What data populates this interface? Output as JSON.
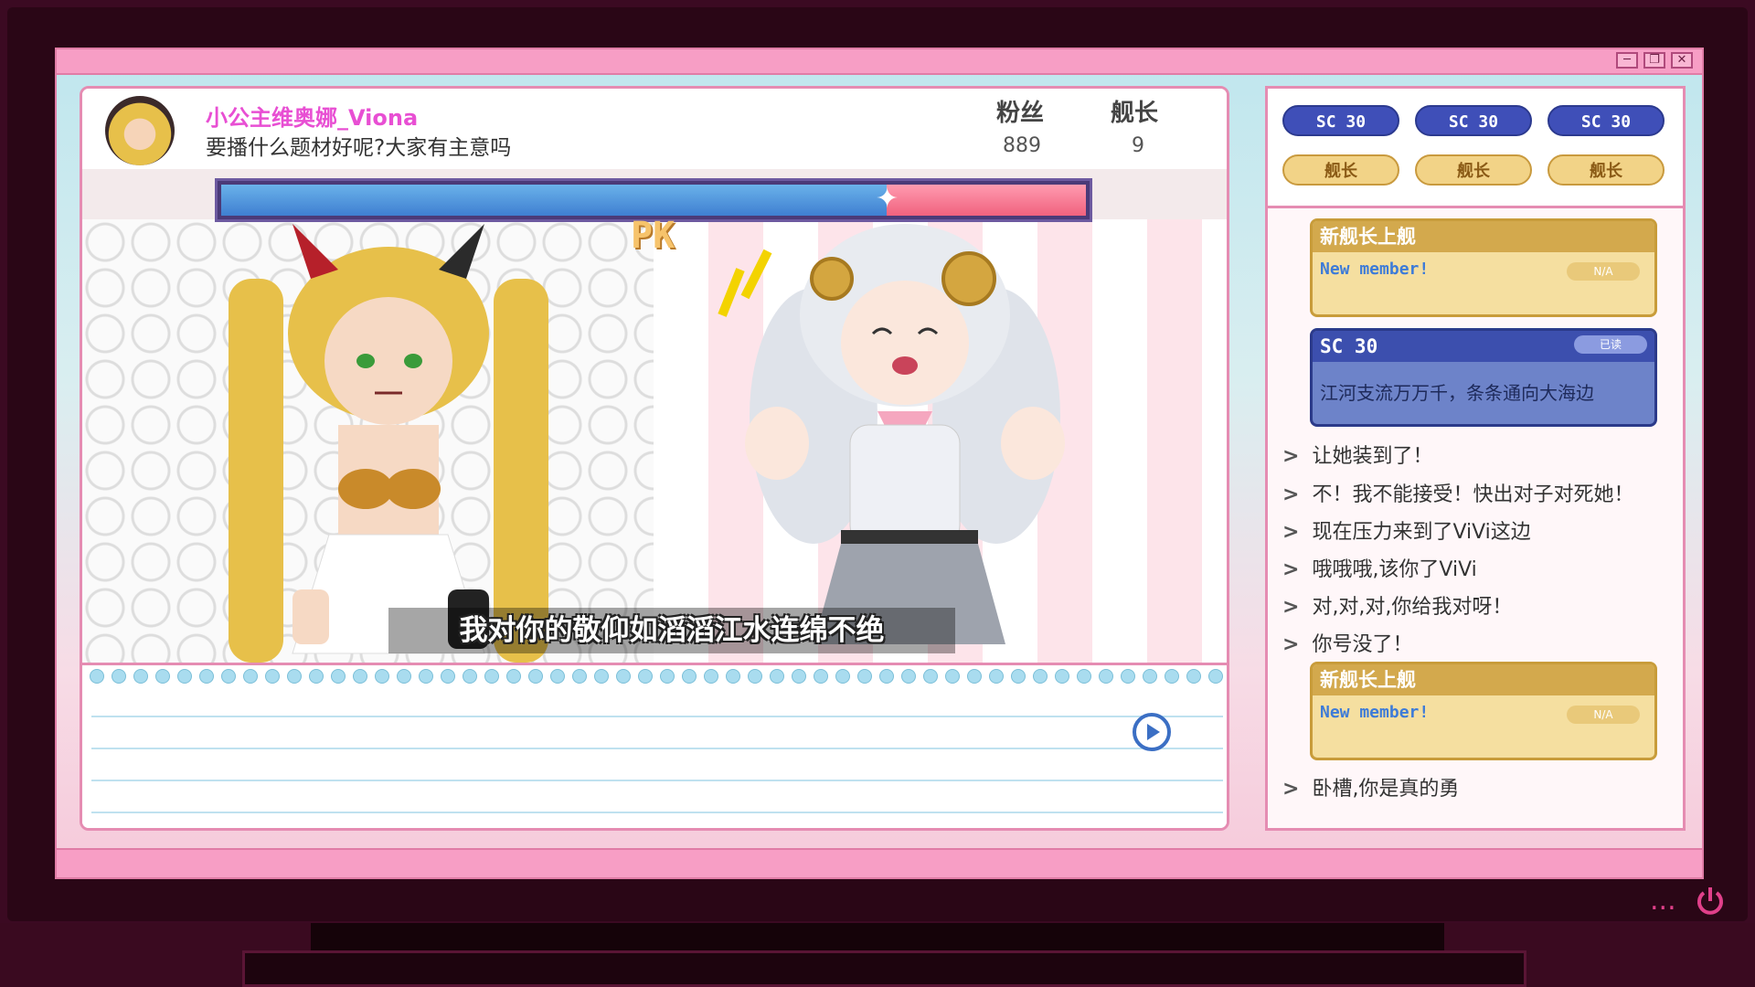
{
  "streamer": {
    "name": "小公主维奥娜_Viona",
    "message": "要播什么题材好呢?大家有主意吗"
  },
  "stats": {
    "fans_label": "粉丝",
    "fans_value": "889",
    "captain_label": "舰长",
    "captain_value": "9"
  },
  "pk": {
    "label": "PK",
    "left_share": 0.77,
    "left_color": "#3f7fd1",
    "right_color": "#f0627e"
  },
  "subtitle": "我对你的敬仰如滔滔江水连绵不绝",
  "side": {
    "sc_pills": [
      "SC 30",
      "SC 30",
      "SC 30"
    ],
    "captain_pills": [
      "舰长",
      "舰长",
      "舰长"
    ],
    "card1": {
      "title": "新舰长上舰",
      "badge": "N/A",
      "body": "New member!"
    },
    "card2": {
      "title": "SC 30",
      "badge": "已读",
      "body": "江河支流万万千，条条通向大海边"
    },
    "chat": [
      "让她装到了！",
      "不！我不能接受！快出对子对死她！",
      "现在压力来到了ViVi这边",
      "哦哦哦,该你了ViVi",
      "对,对,对,你给我对呀！",
      "你号没了！"
    ],
    "card3": {
      "title": "新舰长上舰",
      "badge": "N/A",
      "body": "New member!"
    },
    "chat_last": "卧槽,你是真的勇"
  },
  "tray": {
    "more": "...",
    "power_icon": "power-icon"
  },
  "colors": {
    "titlebar": "#f79ec5",
    "accent": "#e84fd3",
    "sc_blue": "#3f4fb8",
    "captain_gold": "#d3a94d"
  }
}
